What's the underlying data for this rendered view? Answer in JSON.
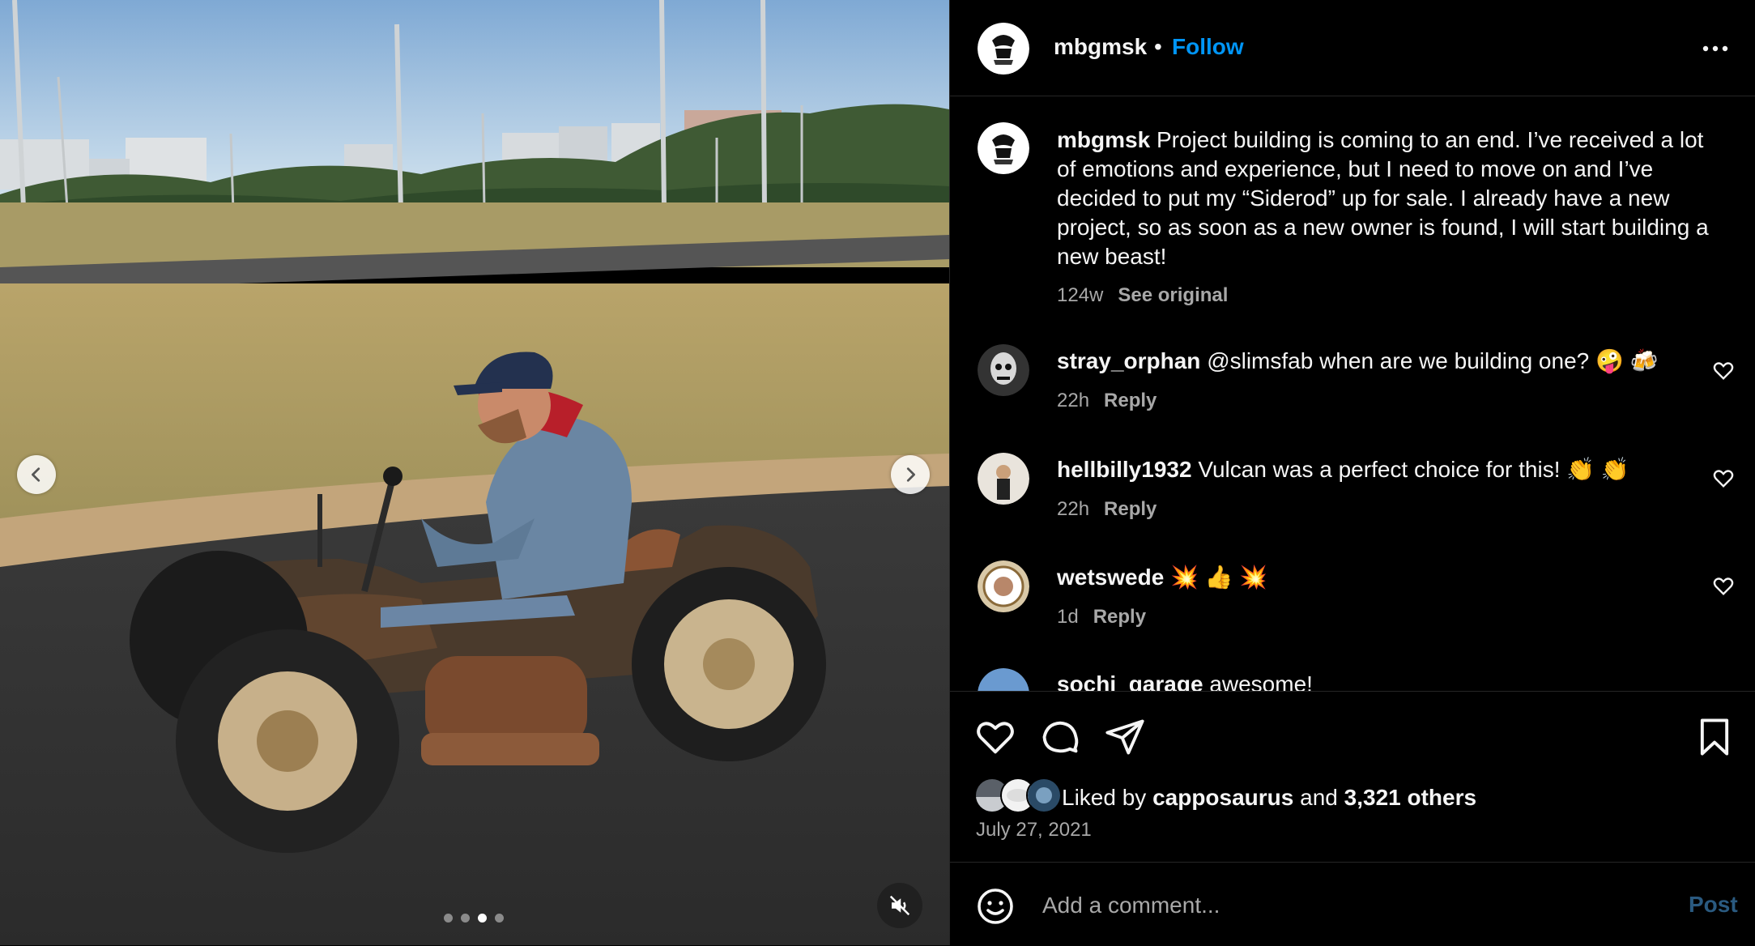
{
  "post": {
    "username": "mbgmsk",
    "follow_label": "Follow",
    "separator": "•",
    "caption_user": "mbgmsk",
    "caption_text": "Project building is coming to an end. I’ve received a lot of emotions and experience, but I need to move on and I’ve decided to put my “Siderod” up for sale. I already have a new project, so as soon as a new owner is found, I will start building a new beast!",
    "caption_age": "124w",
    "see_original_label": "See original",
    "likes_prefix": "Liked by",
    "likes_user": "capposaurus",
    "likes_and": "and",
    "likes_others": "3,321 others",
    "date": "July 27, 2021"
  },
  "comments": [
    {
      "user": "stray_orphan",
      "text": "@slimsfab when are we building one? 🤪 🍻",
      "age": "22h",
      "reply_label": "Reply"
    },
    {
      "user": "hellbilly1932",
      "text": "Vulcan was a perfect choice for this! 👏 👏",
      "age": "22h",
      "reply_label": "Reply"
    },
    {
      "user": "wetswede",
      "text": "💥 👍 💥",
      "age": "1d",
      "reply_label": "Reply"
    },
    {
      "user": "sochi_garage",
      "text": "awesome!"
    }
  ],
  "composer": {
    "placeholder": "Add a comment...",
    "post_label": "Post"
  },
  "carousel": {
    "slide_count": 4,
    "active_index": 2
  },
  "colors": {
    "accent_blue": "#0095f6",
    "muted_text": "#a8a8a8",
    "divider": "#262626"
  },
  "icons": [
    "more-options-icon",
    "heart-icon",
    "comment-icon",
    "share-icon",
    "bookmark-icon",
    "emoji-icon",
    "mute-icon",
    "chevron-left-icon",
    "chevron-right-icon"
  ]
}
